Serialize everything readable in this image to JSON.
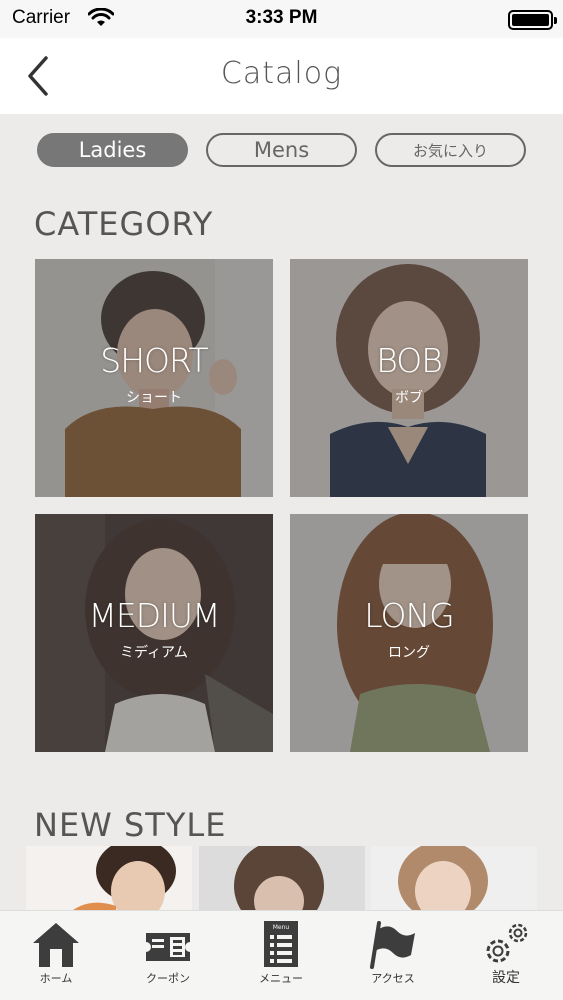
{
  "status_bar": {
    "carrier": "Carrier",
    "time": "3:33 PM",
    "icons": [
      "wifi-icon",
      "battery-icon"
    ]
  },
  "nav": {
    "title": "Catalog",
    "back_icon": "chevron-left-icon"
  },
  "tabs": [
    {
      "label": "Ladies",
      "active": true
    },
    {
      "label": "Mens",
      "active": false
    },
    {
      "label": "お気に入り",
      "active": false
    }
  ],
  "category": {
    "heading": "CATEGORY",
    "items": [
      {
        "label": "SHORT",
        "sub": "ショート"
      },
      {
        "label": "BOB",
        "sub": "ボブ"
      },
      {
        "label": "MEDIUM",
        "sub": "ミディアム"
      },
      {
        "label": "LONG",
        "sub": "ロング"
      }
    ]
  },
  "new_style": {
    "heading": "NEW STYLE"
  },
  "tabbar": {
    "items": [
      {
        "label": "ホーム",
        "icon": "home-icon"
      },
      {
        "label": "クーポン",
        "icon": "coupon-ticket-icon"
      },
      {
        "label": "メニュー",
        "icon": "menu-list-icon",
        "icon_text": "Menu"
      },
      {
        "label": "アクセス",
        "icon": "flag-icon"
      },
      {
        "label": "設定",
        "icon": "gear-icon"
      }
    ]
  },
  "colors": {
    "background": "#ecebe9",
    "tab_active": "#777777",
    "heading": "#555555"
  }
}
